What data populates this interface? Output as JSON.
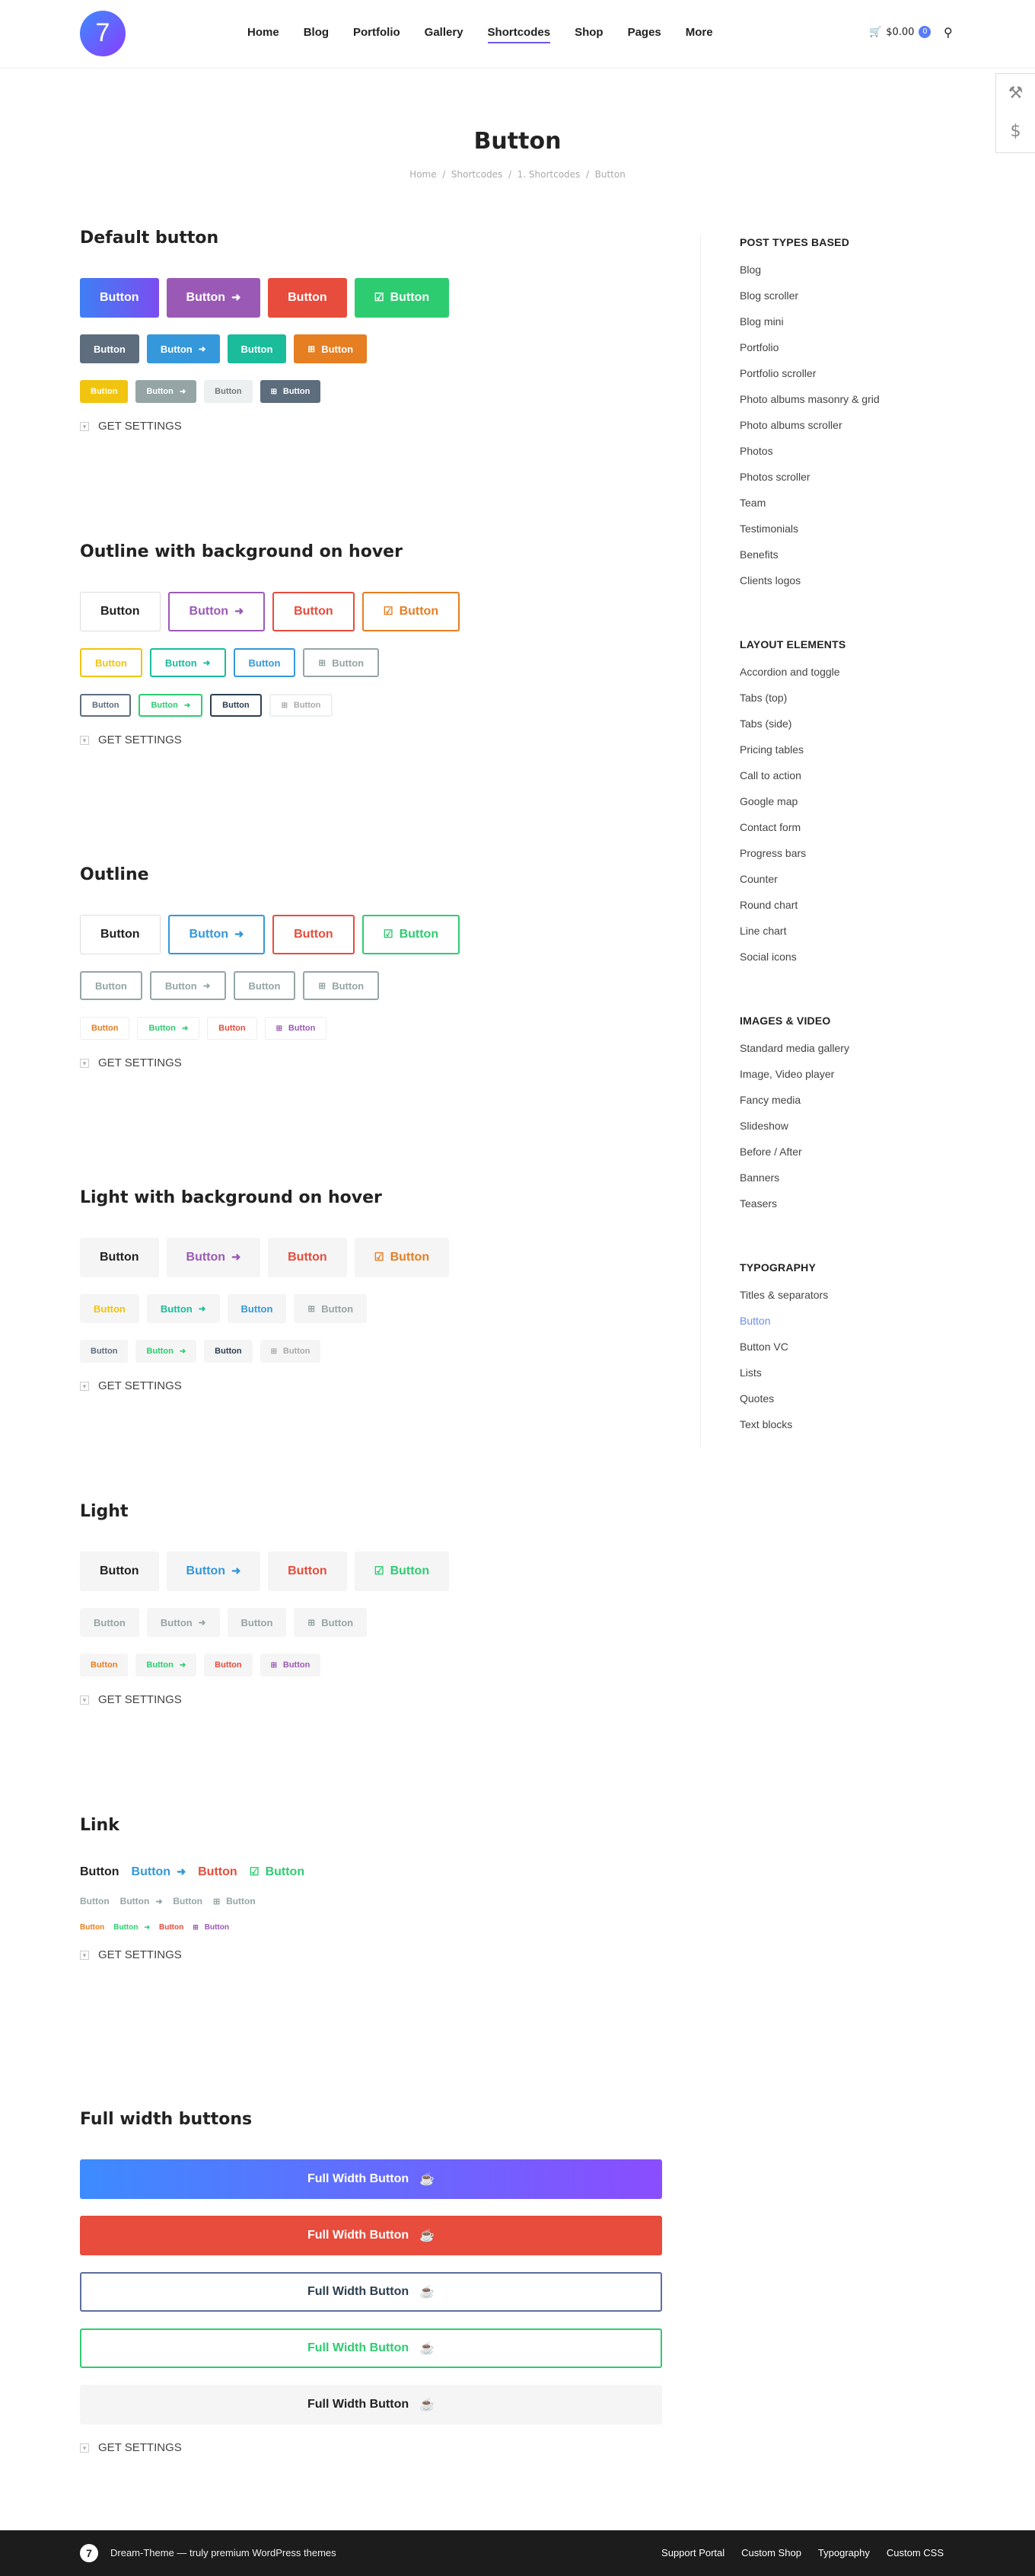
{
  "header": {
    "logo": "7",
    "nav": [
      "Home",
      "Blog",
      "Portfolio",
      "Gallery",
      "Shortcodes",
      "Shop",
      "Pages",
      "More"
    ],
    "cart_total": "$0.00",
    "cart_count": "0"
  },
  "page": {
    "title": "Button",
    "breadcrumb": [
      "Home",
      "Shortcodes",
      "1. Shortcodes",
      "Button"
    ]
  },
  "sections": {
    "default": {
      "title": "Default button"
    },
    "outline_bg": {
      "title": "Outline with background on hover"
    },
    "outline": {
      "title": "Outline"
    },
    "light_bg": {
      "title": "Light with background on hover"
    },
    "light": {
      "title": "Light"
    },
    "link": {
      "title": "Link"
    },
    "full": {
      "title": "Full width buttons"
    }
  },
  "button_label": "Button",
  "full_width_label": "Full Width Button",
  "get_settings": "GET SETTINGS",
  "sidebar": {
    "groups": [
      {
        "title": "POST TYPES BASED",
        "items": [
          "Blog",
          "Blog scroller",
          "Blog mini",
          "Portfolio",
          "Portfolio scroller",
          "Photo albums masonry & grid",
          "Photo albums scroller",
          "Photos",
          "Photos scroller",
          "Team",
          "Testimonials",
          "Benefits",
          "Clients logos"
        ]
      },
      {
        "title": "LAYOUT ELEMENTS",
        "items": [
          "Accordion and toggle",
          "Tabs (top)",
          "Tabs (side)",
          "Pricing tables",
          "Call to action",
          "Google map",
          "Contact form",
          "Progress bars",
          "Counter",
          "Round chart",
          "Line chart",
          "Social icons"
        ]
      },
      {
        "title": "IMAGES & VIDEO",
        "items": [
          "Standard media gallery",
          "Image, Video player",
          "Fancy media",
          "Slideshow",
          "Before / After",
          "Banners",
          "Teasers"
        ]
      },
      {
        "title": "TYPOGRAPHY",
        "items": [
          "Titles & separators",
          "Button",
          "Button VC",
          "Lists",
          "Quotes",
          "Text blocks"
        ]
      }
    ]
  },
  "footer": {
    "text": "Dream-Theme — truly premium WordPress themes",
    "links": [
      "Support Portal",
      "Custom Shop",
      "Typography",
      "Custom CSS"
    ]
  },
  "colors": {
    "accent": "#6c5ce7",
    "blue": "#3498db",
    "purple": "#9b59b6",
    "red": "#e74c3c",
    "green": "#2ecc71",
    "orange": "#e67e22",
    "yellow": "#f1c40f",
    "teal": "#1abc9c",
    "slate": "#5d6d7e"
  }
}
